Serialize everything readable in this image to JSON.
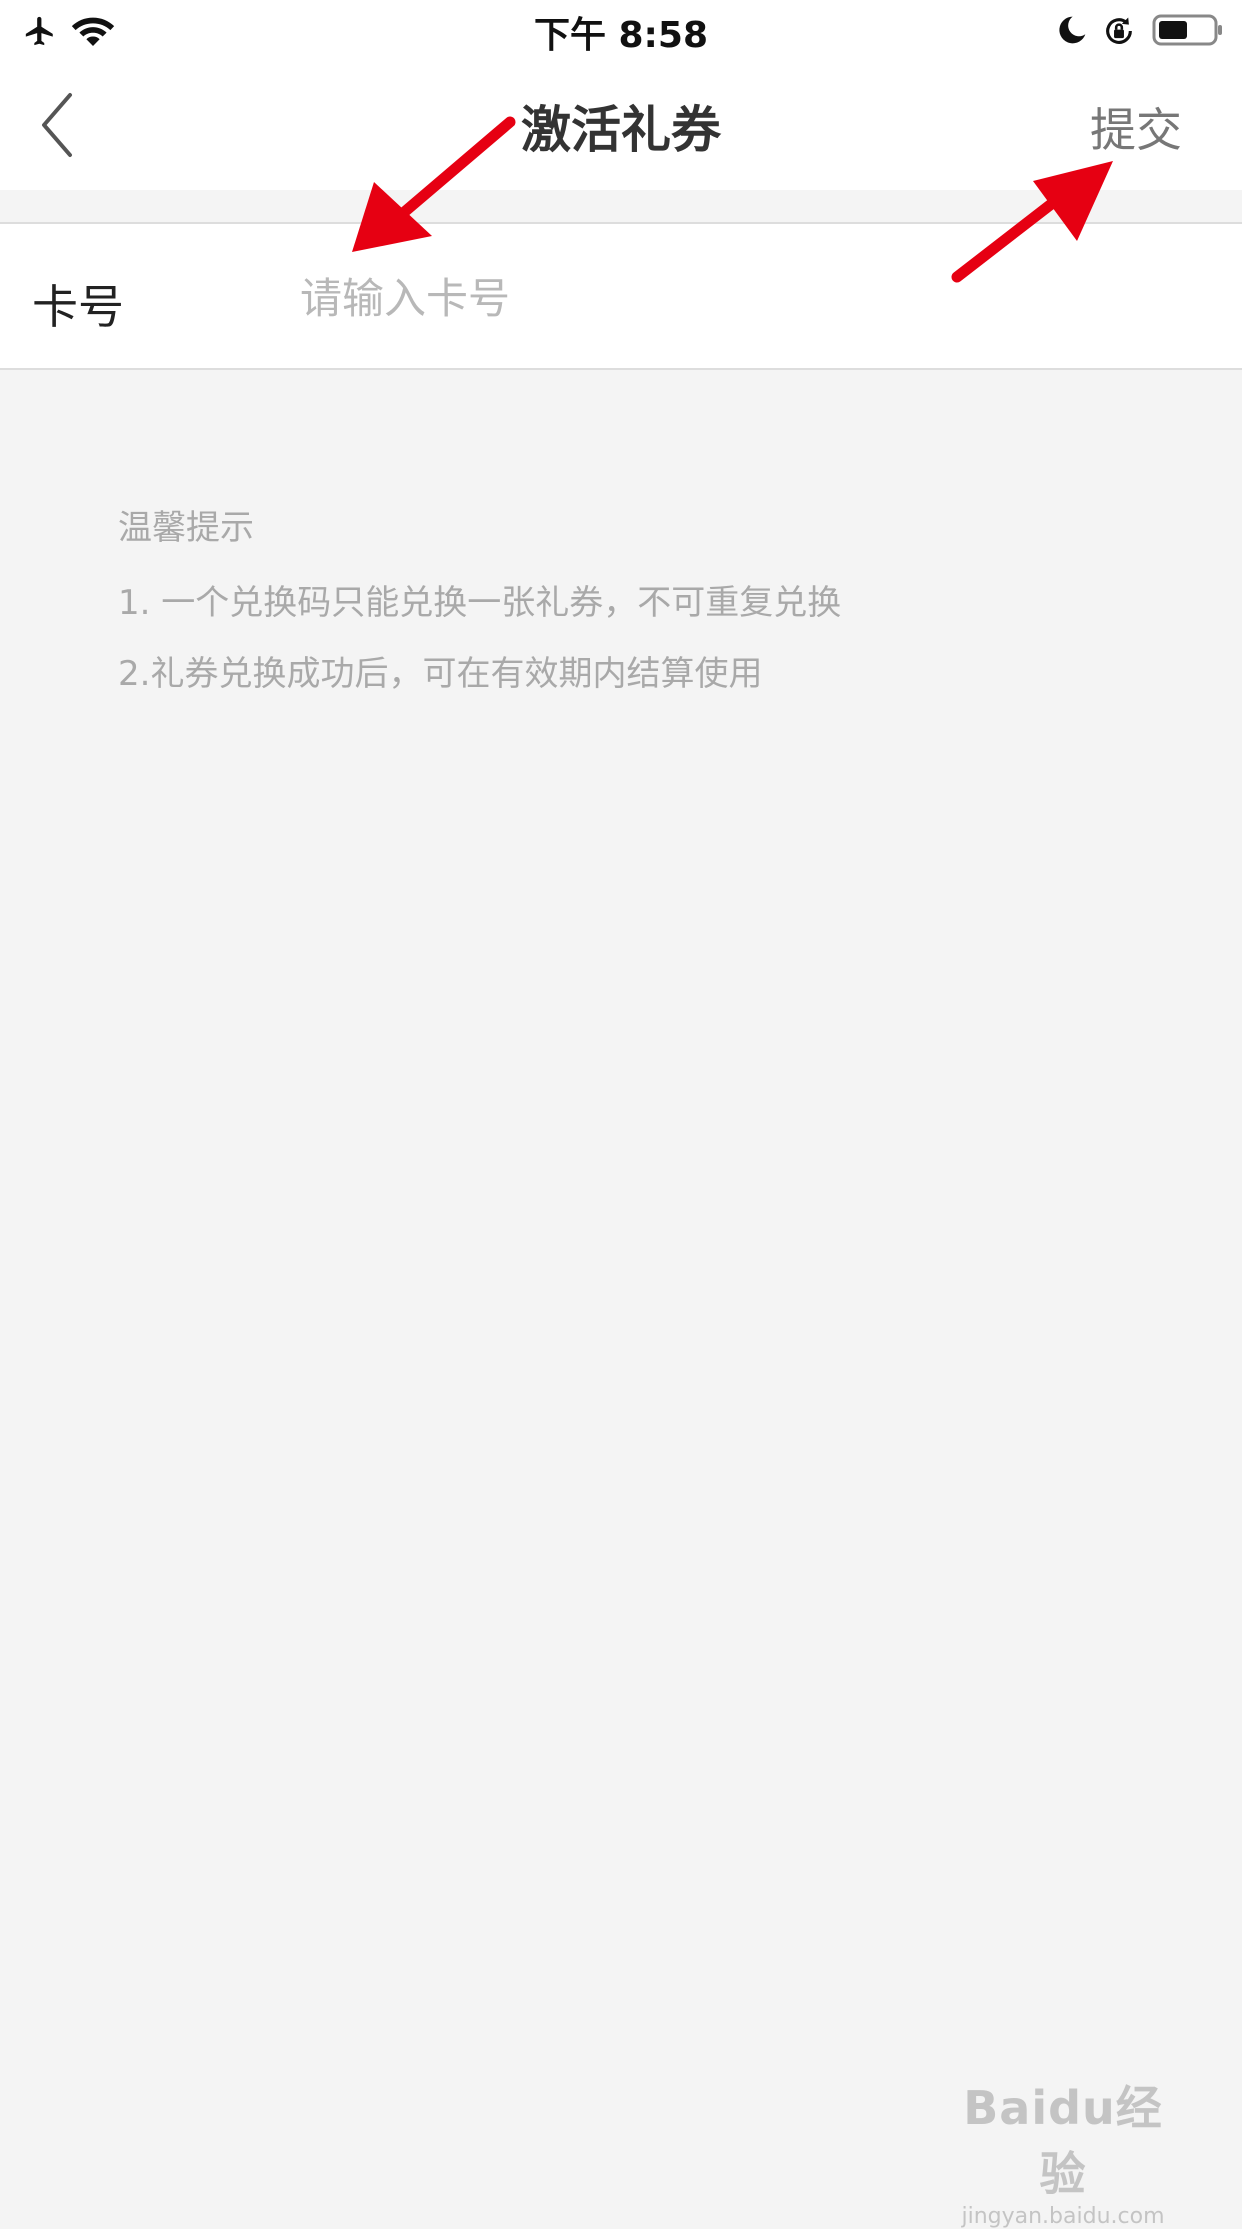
{
  "status_bar": {
    "time": "下午 8:58",
    "icons": [
      "airplane-icon",
      "wifi-icon",
      "moon-icon",
      "rotation-lock-icon",
      "battery-icon"
    ]
  },
  "nav": {
    "back_icon": "chevron-left-icon",
    "title": "激活礼券",
    "submit_label": "提交"
  },
  "form": {
    "label": "卡号",
    "input_value": "",
    "placeholder": "请输入卡号"
  },
  "tips": {
    "title": "温馨提示",
    "items": [
      "1. 一个兑换码只能兑换一张礼券，不可重复兑换",
      "2.礼券兑换成功后，可在有效期内结算使用"
    ]
  },
  "annotations": {
    "color": "#e60012"
  },
  "watermark": {
    "logo": "Baidu经验",
    "url": "jingyan.baidu.com"
  },
  "colors": {
    "background": "#f4f4f4",
    "title": "#333333",
    "submit": "#777777",
    "placeholder": "#b8b8b8",
    "tips": "#a9a9a9"
  }
}
